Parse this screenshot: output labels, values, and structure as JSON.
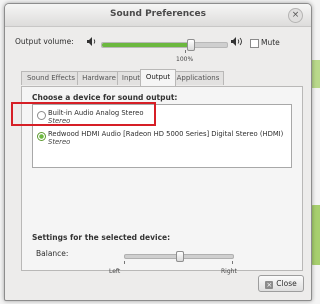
{
  "window": {
    "title": "Sound Preferences",
    "close_glyph": "×"
  },
  "output_volume": {
    "label": "Output volume:",
    "level_percent": 70,
    "tick_label": "100%",
    "low_icon": "speaker-low-icon",
    "high_icon": "speaker-high-icon",
    "mute_label": "Mute",
    "mute_checked": false
  },
  "tabs": [
    {
      "label": "Sound Effects",
      "active": false
    },
    {
      "label": "Hardware",
      "active": false
    },
    {
      "label": "Input",
      "active": false
    },
    {
      "label": "Output",
      "active": true
    },
    {
      "label": "Applications",
      "active": false
    }
  ],
  "output": {
    "choose_title": "Choose a device for sound output:",
    "devices": [
      {
        "name": "Built-in Audio Analog Stereo",
        "type": "Stereo",
        "selected": false
      },
      {
        "name": "Redwood HDMI Audio [Radeon HD 5000 Series] Digital Stereo (HDMI)",
        "type": "Stereo",
        "selected": true
      }
    ],
    "settings_title": "Settings for the selected device:",
    "balance": {
      "label": "Balance:",
      "left": "Left",
      "right": "Right",
      "value_percent": 50
    }
  },
  "buttons": {
    "close_label": "Close"
  },
  "colors": {
    "accent": "#6cb83f",
    "highlight": "#d61f26"
  }
}
